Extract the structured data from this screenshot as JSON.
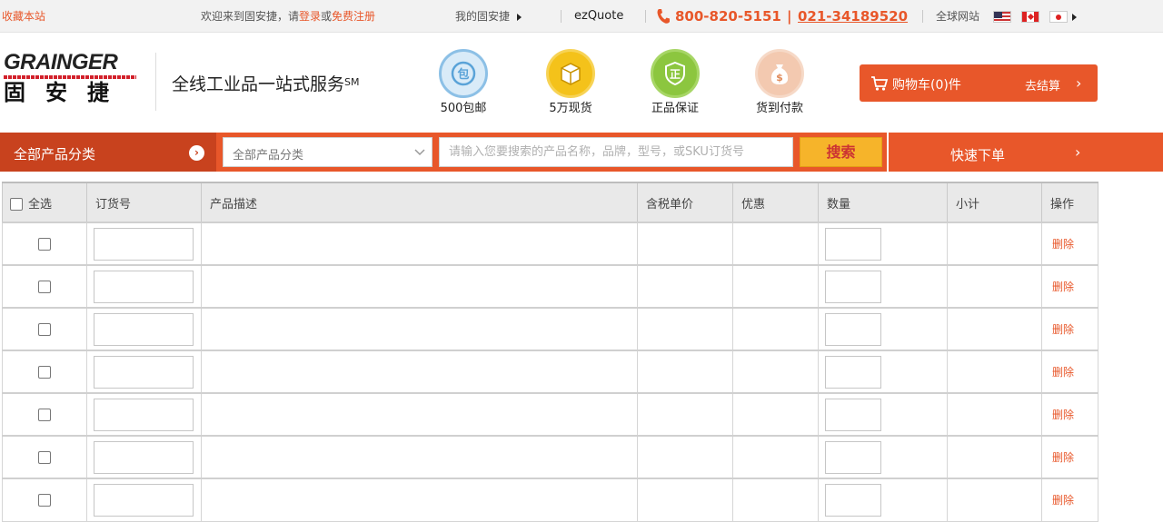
{
  "topbar": {
    "bookmark": "收藏本站",
    "welcome": "欢迎来到固安捷，请",
    "login": "登录",
    "or": "或",
    "register": "免费注册",
    "my_account": "我的固安捷",
    "ezquote": "ezQuote",
    "phone1": "800-820-5151",
    "phone_sep": "|",
    "phone2": "021-34189520",
    "global": "全球网站"
  },
  "logo": {
    "en": "GRAINGER",
    "cn": "固安捷"
  },
  "slogan": {
    "text": "全线工业品一站式服务",
    "mark": "SM"
  },
  "features": [
    {
      "label": "500包邮",
      "icon": "free-shipping-icon"
    },
    {
      "label": "5万现货",
      "icon": "in-stock-box-icon"
    },
    {
      "label": "正品保证",
      "icon": "genuine-guarantee-icon"
    },
    {
      "label": "货到付款",
      "icon": "cash-on-delivery-icon"
    }
  ],
  "cart": {
    "label": "购物车(0)件",
    "checkout": "去结算"
  },
  "nav": {
    "all_categories": "全部产品分类",
    "category_select": "全部产品分类",
    "search_placeholder": "请输入您要搜索的产品名称，品牌，型号，或SKU订货号",
    "search_button": "搜索",
    "quick_order": "快速下单"
  },
  "table": {
    "headers": {
      "select_all": "全选",
      "order_no": "订货号",
      "description": "产品描述",
      "unit_price": "含税单价",
      "discount": "优惠",
      "quantity": "数量",
      "subtotal": "小计",
      "action": "操作"
    },
    "delete_label": "删除"
  },
  "colors": {
    "accent": "#e8572a",
    "accent_dark": "#c8421e",
    "search_button": "#f6b42a"
  }
}
